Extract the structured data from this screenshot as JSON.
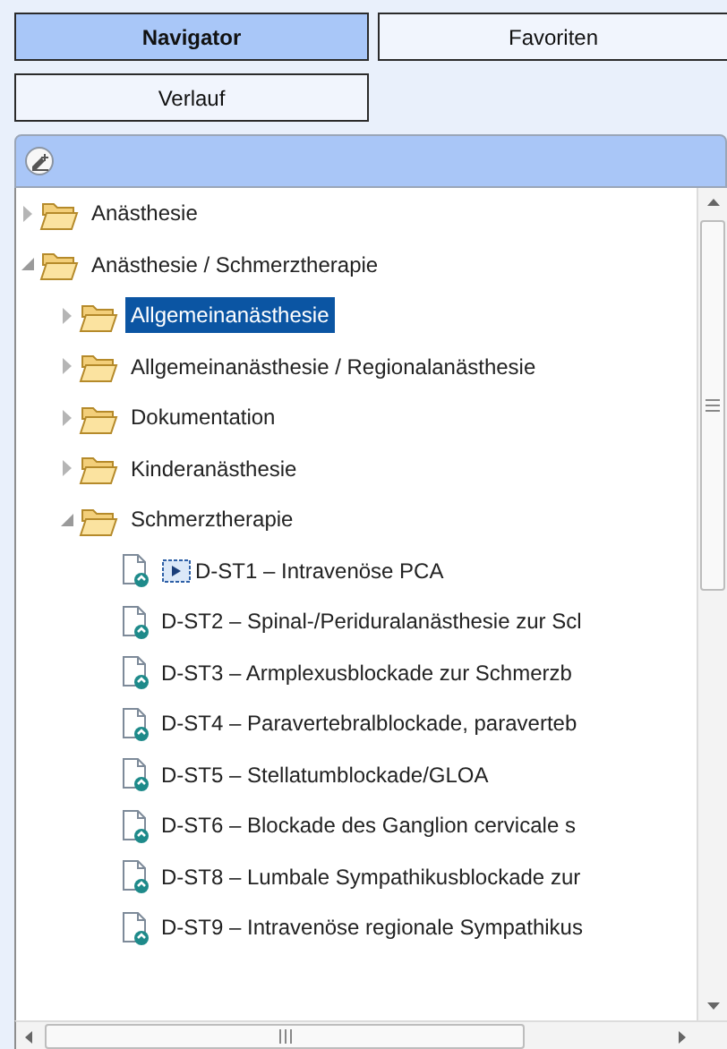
{
  "tabs": [
    {
      "label": "Navigator",
      "selected": true
    },
    {
      "label": "Favoriten",
      "selected": false
    },
    {
      "label": "Verlauf",
      "selected": false
    }
  ],
  "tree": [
    {
      "label": "Anästhesie",
      "kind": "folder",
      "expanded": false,
      "selected": false
    },
    {
      "label": "Anästhesie / Schmerztherapie",
      "kind": "folder",
      "expanded": true,
      "selected": false,
      "children": [
        {
          "label": "Allgemeinanästhesie",
          "kind": "folder",
          "expanded": false,
          "selected": true
        },
        {
          "label": "Allgemeinanästhesie / Regionalanästhesie",
          "kind": "folder",
          "expanded": false,
          "selected": false
        },
        {
          "label": "Dokumentation",
          "kind": "folder",
          "expanded": false,
          "selected": false
        },
        {
          "label": "Kinderanästhesie",
          "kind": "folder",
          "expanded": false,
          "selected": false
        },
        {
          "label": "Schmerztherapie",
          "kind": "folder",
          "expanded": true,
          "selected": false,
          "children": [
            {
              "label": "D-ST1 – Intravenöse PCA",
              "kind": "document",
              "running": true,
              "selected": false
            },
            {
              "label": "D-ST2 – Spinal-/Periduralanästhesie zur Scl",
              "kind": "document",
              "running": false,
              "selected": false
            },
            {
              "label": "D-ST3 – Armplexusblockade zur Schmerzb",
              "kind": "document",
              "running": false,
              "selected": false
            },
            {
              "label": "D-ST4 – Paravertebralblockade, paraverteb",
              "kind": "document",
              "running": false,
              "selected": false
            },
            {
              "label": "D-ST5 – Stellatumblockade/GLOA",
              "kind": "document",
              "running": false,
              "selected": false
            },
            {
              "label": "D-ST6 – Blockade des Ganglion cervicale s",
              "kind": "document",
              "running": false,
              "selected": false
            },
            {
              "label": "D-ST8 – Lumbale Sympathikusblockade zur",
              "kind": "document",
              "running": false,
              "selected": false
            },
            {
              "label": "D-ST9 – Intravenöse regionale Sympathikus",
              "kind": "document",
              "running": false,
              "selected": false
            }
          ]
        }
      ]
    }
  ]
}
